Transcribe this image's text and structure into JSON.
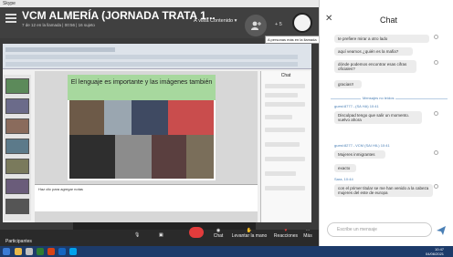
{
  "window": {
    "title": "Skype"
  },
  "meeting": {
    "title": "VCM ALMERÍA (JORNADA TRATA 1...",
    "subtitle": "7 de 12 en la llamada | 00:56 | 16 sujeto",
    "share_label": "À vista Contenido",
    "participants_count": "+ 5",
    "avatar_tooltip": "A personas más en la llamada"
  },
  "slide": {
    "title": "El lenguaje es importante y las imágenes también",
    "notes": "Haz clic para agregar notas"
  },
  "inner_chat": {
    "title": "Chat"
  },
  "controls": {
    "participants": "Participantes",
    "chat": "Chat",
    "raise_hand": "Levantar la mano",
    "reactions": "Reacciones",
    "more": "Más"
  },
  "chat": {
    "title": "Chat",
    "close_icon": "x-icon",
    "messages": [
      {
        "text": "te prefiere mirar a otro lado",
        "meta": ""
      },
      {
        "text": "aquí veamos ¿quién es la mafia?",
        "meta": ""
      },
      {
        "text": "dónde podemos encontrar esas cifras oficiales?",
        "meta": ""
      },
      {
        "text": "gracias!!",
        "meta": ""
      },
      {
        "text": "Disculpad tengo que salir un momento. vuelvo ahora",
        "meta": "guest:8777...(SA HA) 10:41"
      },
      {
        "text": "Mujeres inmigrantes",
        "meta": "guest:8277...VCM (SAI HIL) 10:41"
      },
      {
        "text": "exacto",
        "meta": ""
      },
      {
        "text": "con el primer titular se me han venido a la cabeza mujeres del este de europa",
        "meta": "Sara, 10:44"
      }
    ],
    "divider": "Mensajes no leídos",
    "input_placeholder": "Escribe un mensaje"
  },
  "taskbar": {
    "time": "10:47",
    "date": "04/06/2021"
  },
  "colors": {
    "end_call": "#e23c3c",
    "slide_header": "#a7d89e",
    "taskbar": "#1d3b6a"
  }
}
